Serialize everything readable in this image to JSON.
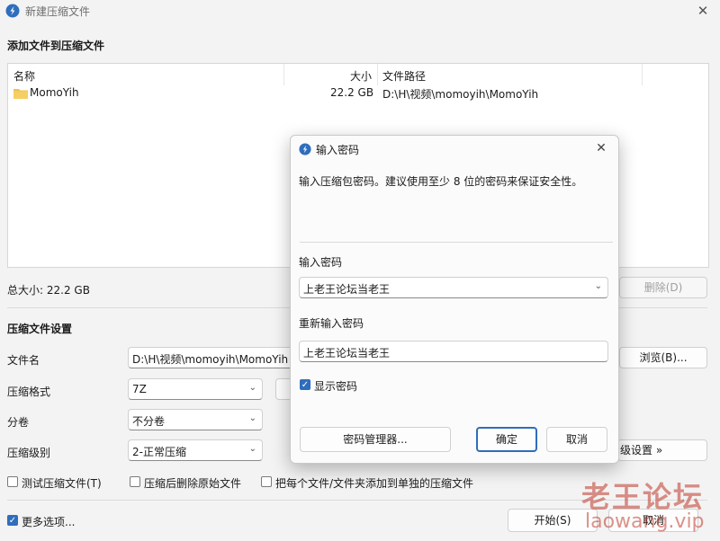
{
  "window": {
    "title": "新建压缩文件",
    "close_glyph": "✕"
  },
  "files": {
    "section_title": "添加文件到压缩文件",
    "columns": [
      "名称",
      "大小",
      "文件路径"
    ],
    "rows": [
      {
        "name": "MomoYih",
        "size": "22.2 GB",
        "path": "D:\\H\\视频\\momoyih\\MomoYih"
      }
    ],
    "total_size": "总大小: 22.2 GB",
    "delete_button": "删除(D)"
  },
  "settings": {
    "section_title": "压缩文件设置",
    "filename_label": "文件名",
    "filename_value": "D:\\H\\视频\\momoyih\\MomoYih",
    "browse_button": "浏览(B)...",
    "format_label": "压缩格式",
    "format_value": "7Z",
    "volume_label": "分卷",
    "volume_value": "不分卷",
    "level_label": "压缩级别",
    "level_value": "2-正常压缩",
    "advanced_button": "级设置 »",
    "test_checkbox": "测试压缩文件(T)",
    "delete_after_checkbox": "压缩后删除原始文件",
    "separate_checkbox": "把每个文件/文件夹添加到单独的压缩文件",
    "more_options_checkbox": "更多选项...",
    "start_button": "开始(S)",
    "cancel_button": "取消"
  },
  "dialog": {
    "title": "输入密码",
    "description": "输入压缩包密码。建议使用至少 8 位的密码来保证安全性。",
    "password_label": "输入密码",
    "password_value": "上老王论坛当老王",
    "reenter_label": "重新输入密码",
    "reenter_value": "上老王论坛当老王",
    "show_password": "显示密码",
    "manager_button": "密码管理器...",
    "ok_button": "确定",
    "cancel_button": "取消",
    "close_glyph": "✕"
  },
  "watermark": {
    "text1": "老王论坛",
    "text2": "laowang.vip"
  },
  "icons": {
    "app": "app-arrow-icon",
    "folder": "folder-icon",
    "check": "✓",
    "chevron": "⌄"
  },
  "colors": {
    "accent": "#2f6dbd",
    "folder": "#f2c14e"
  }
}
